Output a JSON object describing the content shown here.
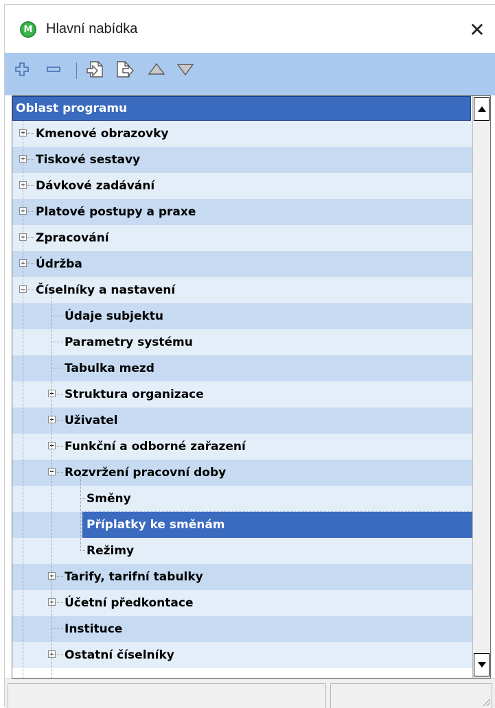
{
  "window": {
    "title": "Hlavní nabídka",
    "app_icon_letter": "M",
    "close_glyph": "✕"
  },
  "toolbar": {
    "buttons": [
      {
        "name": "expand-all-icon"
      },
      {
        "name": "collapse-all-icon"
      },
      {
        "name": "insert-before-icon"
      },
      {
        "name": "insert-after-icon"
      },
      {
        "name": "move-up-icon"
      },
      {
        "name": "move-down-icon"
      }
    ]
  },
  "tree": {
    "header": "Oblast programu",
    "rows": [
      {
        "label": "Kmenové obrazovky",
        "level": 0,
        "expander": "plus"
      },
      {
        "label": "Tiskové sestavy",
        "level": 0,
        "expander": "plus"
      },
      {
        "label": "Dávkové zadávání",
        "level": 0,
        "expander": "plus"
      },
      {
        "label": "Platové postupy a praxe",
        "level": 0,
        "expander": "plus"
      },
      {
        "label": "Zpracování",
        "level": 0,
        "expander": "plus"
      },
      {
        "label": "Údržba",
        "level": 0,
        "expander": "plus"
      },
      {
        "label": "Číselníky a nastavení",
        "level": 0,
        "expander": "minus"
      },
      {
        "label": "Údaje subjektu",
        "level": 1,
        "expander": "none"
      },
      {
        "label": "Parametry systému",
        "level": 1,
        "expander": "none"
      },
      {
        "label": "Tabulka mezd",
        "level": 1,
        "expander": "none"
      },
      {
        "label": "Struktura organizace",
        "level": 1,
        "expander": "plus"
      },
      {
        "label": "Uživatel",
        "level": 1,
        "expander": "plus"
      },
      {
        "label": "Funkční a odborné zařazení",
        "level": 1,
        "expander": "plus"
      },
      {
        "label": "Rozvržení pracovní doby",
        "level": 1,
        "expander": "minus"
      },
      {
        "label": "Směny",
        "level": 2,
        "expander": "none"
      },
      {
        "label": "Příplatky ke směnám",
        "level": 2,
        "expander": "none",
        "selected": true
      },
      {
        "label": "Režimy",
        "level": 2,
        "expander": "none"
      },
      {
        "label": "Tarify, tarifní tabulky",
        "level": 1,
        "expander": "plus"
      },
      {
        "label": "Účetní předkontace",
        "level": 1,
        "expander": "plus"
      },
      {
        "label": "Instituce",
        "level": 1,
        "expander": "none"
      },
      {
        "label": "Ostatní číselníky",
        "level": 1,
        "expander": "plus"
      }
    ]
  },
  "colors": {
    "toolbar_bg": "#aac9ee",
    "row_light": "#e4eef9",
    "row_dark": "#c6daf1",
    "selection": "#3a6bbf",
    "app_icon_green": "#39b54a"
  }
}
